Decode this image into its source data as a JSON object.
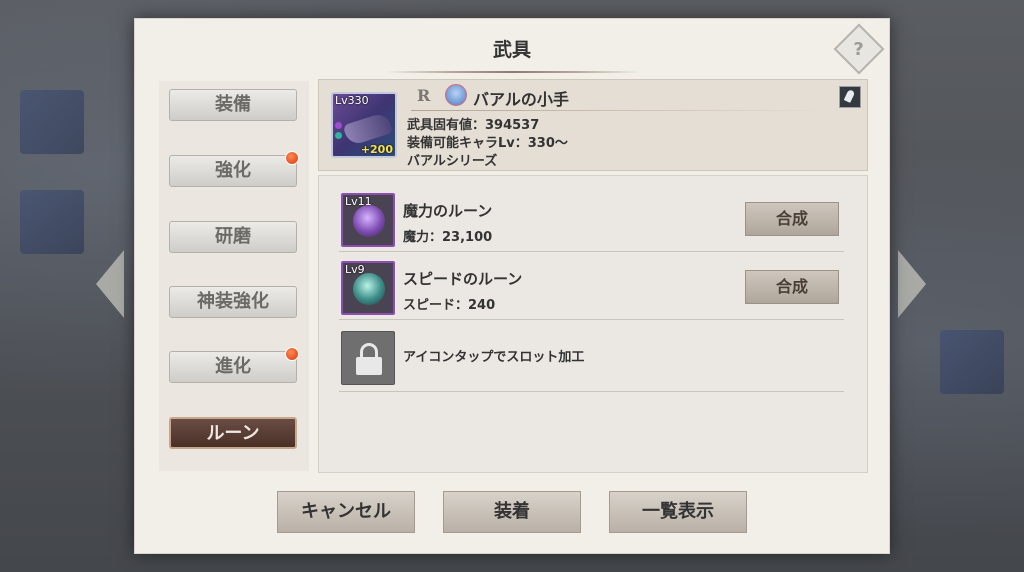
{
  "dialog": {
    "title": "武具",
    "help_icon": "?"
  },
  "tabs": [
    {
      "label": "装備",
      "active": false,
      "badge": false
    },
    {
      "label": "強化",
      "active": false,
      "badge": true
    },
    {
      "label": "研磨",
      "active": false,
      "badge": false
    },
    {
      "label": "神装強化",
      "active": false,
      "badge": false
    },
    {
      "label": "進化",
      "active": false,
      "badge": true
    },
    {
      "label": "ルーン",
      "active": true,
      "badge": false
    }
  ],
  "item": {
    "level": "Lv330",
    "plus": "+200",
    "rarity": "R",
    "name": "バアルの小手",
    "unique_value": "武具固有値：394537",
    "equip_level": "装備可能キャラLv：330〜",
    "series": "バアルシリーズ"
  },
  "runes": [
    {
      "level": "Lv11",
      "name": "魔力のルーン",
      "stat": "魔力：23,100",
      "button": "合成",
      "orb_color": "#7d4bb0"
    },
    {
      "level": "Lv9",
      "name": "スピードのルーン",
      "stat": "スピード：240",
      "button": "合成",
      "orb_color": "#3a8a86"
    }
  ],
  "locked_slot": {
    "text": "アイコンタップでスロット加工",
    "icon": "lock-icon"
  },
  "buttons": {
    "cancel": "キャンセル",
    "equip": "装着",
    "list": "一覧表示"
  },
  "colors": {
    "active_tab": "#4a3028",
    "badge": "#d8380a",
    "rune_border": "#8c4fb1"
  }
}
